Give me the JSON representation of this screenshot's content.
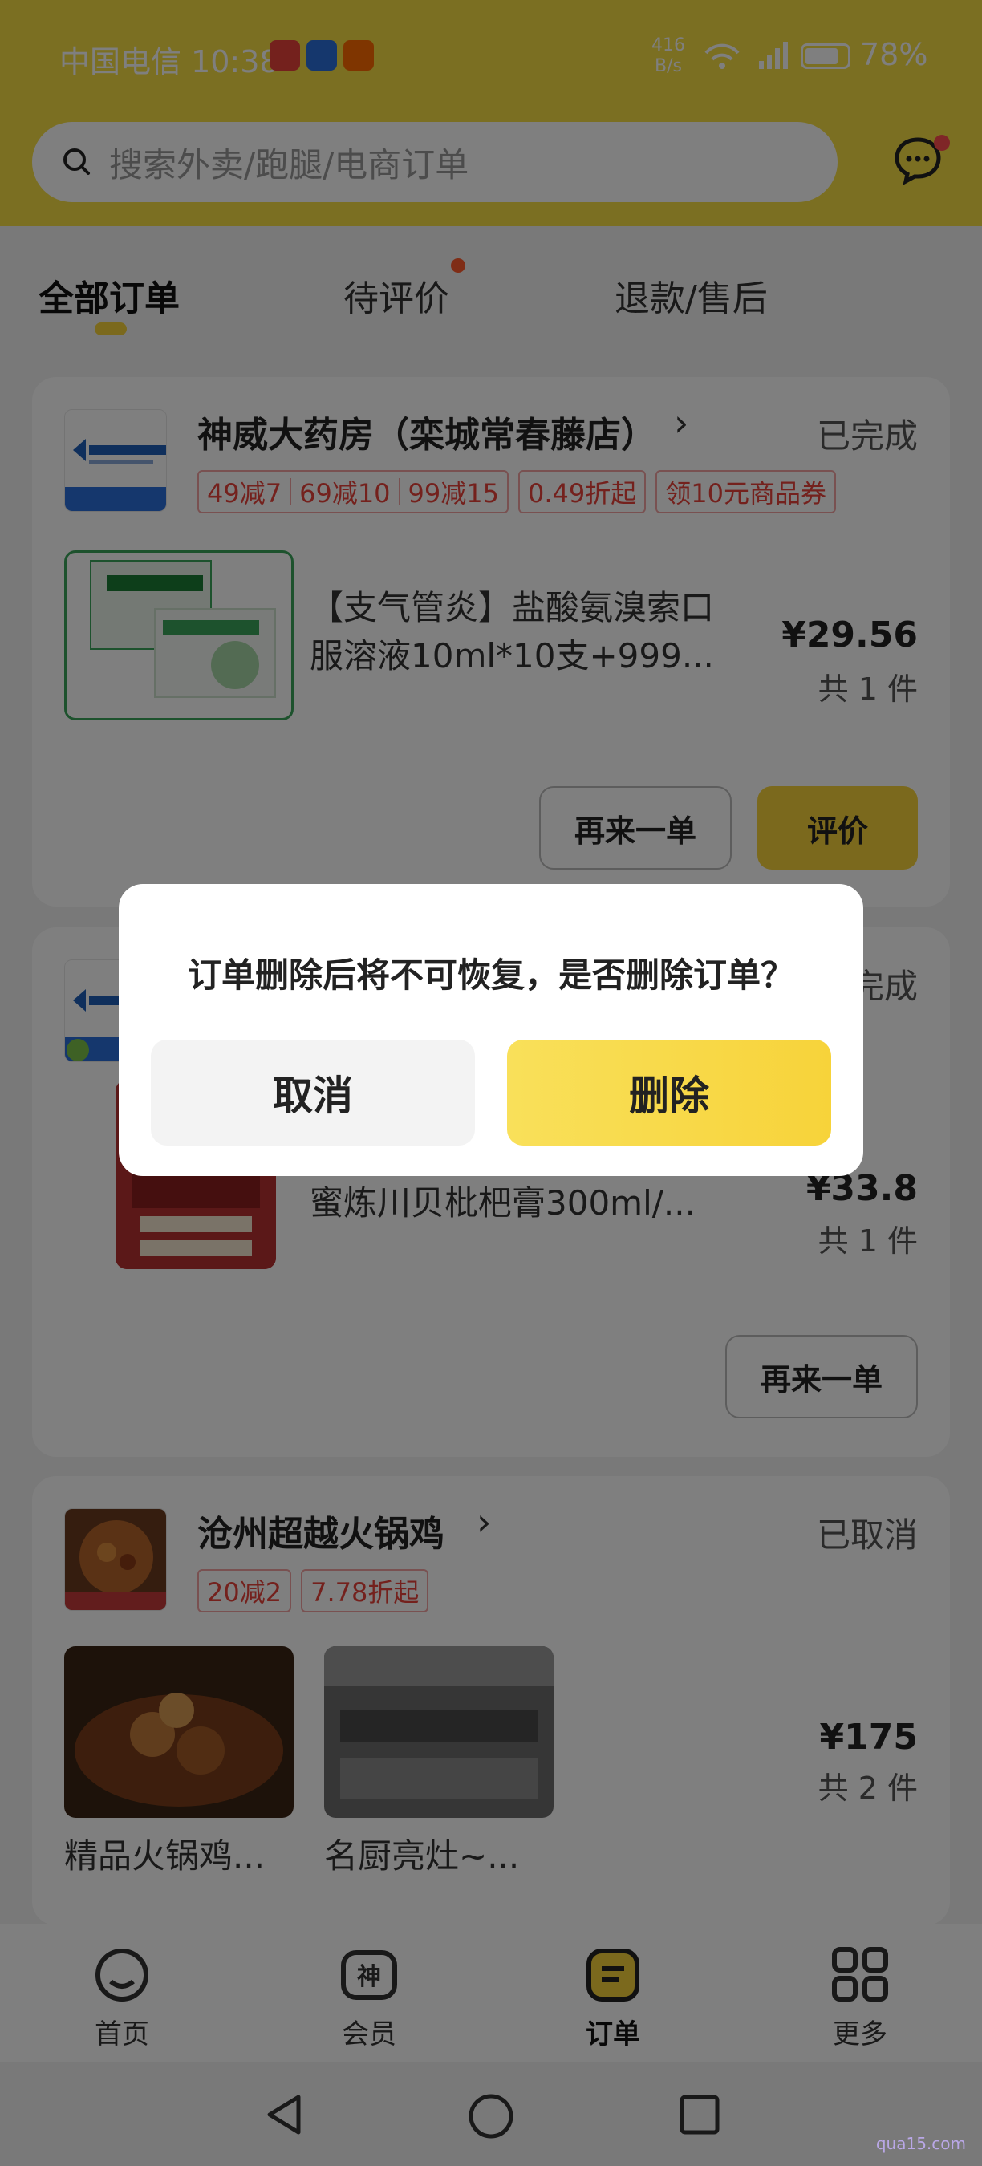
{
  "status_bar": {
    "carrier_time": "中国电信 10:38",
    "net_speed_value": "416",
    "net_speed_unit": "B/s",
    "battery": "78%"
  },
  "search": {
    "placeholder": "搜索外卖/跑腿/电商订单"
  },
  "tabs": [
    {
      "label": "全部订单"
    },
    {
      "label": "待评价"
    },
    {
      "label": "退款/售后"
    }
  ],
  "orders": [
    {
      "shop": "神威大药房（栾城常春藤店）",
      "status": "已完成",
      "promos": [
        "49减7",
        "69减10",
        "99减15",
        "0.49折起",
        "领10元商品券"
      ],
      "product_line1": "【支气管炎】盐酸氨溴索口",
      "product_line2": "服溶液10ml*10支+999...",
      "price": "¥29.56",
      "qty": "共 1 件",
      "buttons": {
        "reorder": "再来一单",
        "review": "评价"
      }
    },
    {
      "status": "已完成",
      "product": "蜜炼川贝枇杷膏300ml/...",
      "price": "¥33.8",
      "qty": "共 1 件",
      "buttons": {
        "reorder": "再来一单"
      }
    },
    {
      "shop": "沧州超越火锅鸡",
      "status": "已取消",
      "promos": [
        "20减2",
        "7.78折起"
      ],
      "items": [
        "精品火锅鸡...",
        "名厨亮灶~..."
      ],
      "price": "¥175",
      "qty": "共 2 件"
    }
  ],
  "dialog": {
    "message": "订单删除后将不可恢复，是否删除订单？",
    "cancel": "取消",
    "delete": "删除"
  },
  "bottom_nav": [
    {
      "label": "首页",
      "icon": "home-icon"
    },
    {
      "label": "会员",
      "icon": "member-icon"
    },
    {
      "label": "订单",
      "icon": "order-icon"
    },
    {
      "label": "更多",
      "icon": "more-icon"
    }
  ],
  "watermark": "qua15.com",
  "colors": {
    "brand_yellow": "#f7d33a",
    "promo_red": "#e8423a"
  }
}
